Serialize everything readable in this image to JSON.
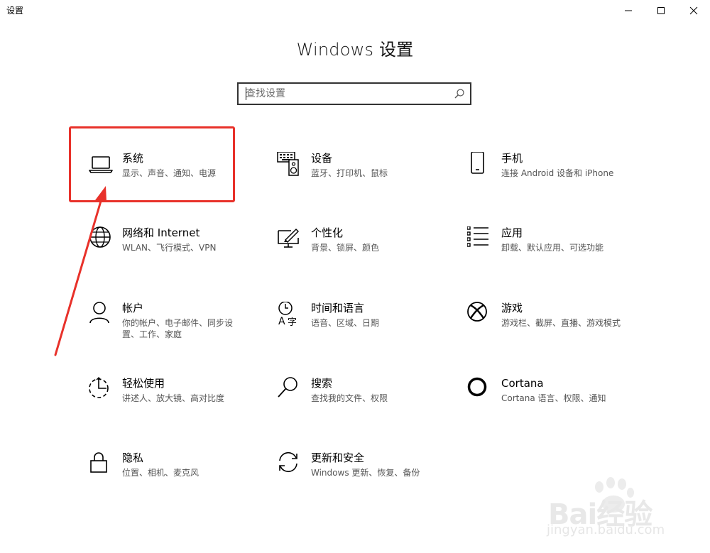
{
  "window": {
    "app_title": "设置",
    "controls": [
      "minimize-icon",
      "maximize-icon",
      "close-icon"
    ]
  },
  "page_title": "Windows 设置",
  "search": {
    "placeholder": "查找设置",
    "icon": "search-icon"
  },
  "tiles": [
    {
      "name": "系统",
      "desc": "显示、声音、通知、电源",
      "icon": "laptop-icon"
    },
    {
      "name": "设备",
      "desc": "蓝牙、打印机、鼠标",
      "icon": "devices-icon"
    },
    {
      "name": "手机",
      "desc": "连接 Android 设备和 iPhone",
      "icon": "phone-icon"
    },
    {
      "name": "网络和 Internet",
      "desc": "WLAN、飞行模式、VPN",
      "icon": "globe-icon"
    },
    {
      "name": "个性化",
      "desc": "背景、锁屏、颜色",
      "icon": "personalization-icon"
    },
    {
      "name": "应用",
      "desc": "卸载、默认应用、可选功能",
      "icon": "apps-list-icon"
    },
    {
      "name": "帐户",
      "desc": "你的帐户、电子邮件、同步设置、工作、家庭",
      "icon": "person-icon"
    },
    {
      "name": "时间和语言",
      "desc": "语音、区域、日期",
      "icon": "time-language-icon"
    },
    {
      "name": "游戏",
      "desc": "游戏栏、截屏、直播、游戏模式",
      "icon": "xbox-icon"
    },
    {
      "name": "轻松使用",
      "desc": "讲述人、放大镜、高对比度",
      "icon": "ease-of-access-icon"
    },
    {
      "name": "搜索",
      "desc": "查找我的文件、权限",
      "icon": "search-icon"
    },
    {
      "name": "Cortana",
      "desc": "Cortana 语言、权限、通知",
      "icon": "cortana-icon"
    },
    {
      "name": "隐私",
      "desc": "位置、相机、麦克风",
      "icon": "lock-icon"
    },
    {
      "name": "更新和安全",
      "desc": "Windows 更新、恢复、备份",
      "icon": "sync-icon"
    }
  ],
  "annotation": {
    "highlight_color": "#e8312a"
  },
  "watermark": {
    "brand": "Bai经验",
    "url": "jingyan.baidu.com"
  },
  "colors": {
    "background": "#ffffff",
    "text": "#000000",
    "subtext": "#555555",
    "highlight": "#e8312a"
  }
}
